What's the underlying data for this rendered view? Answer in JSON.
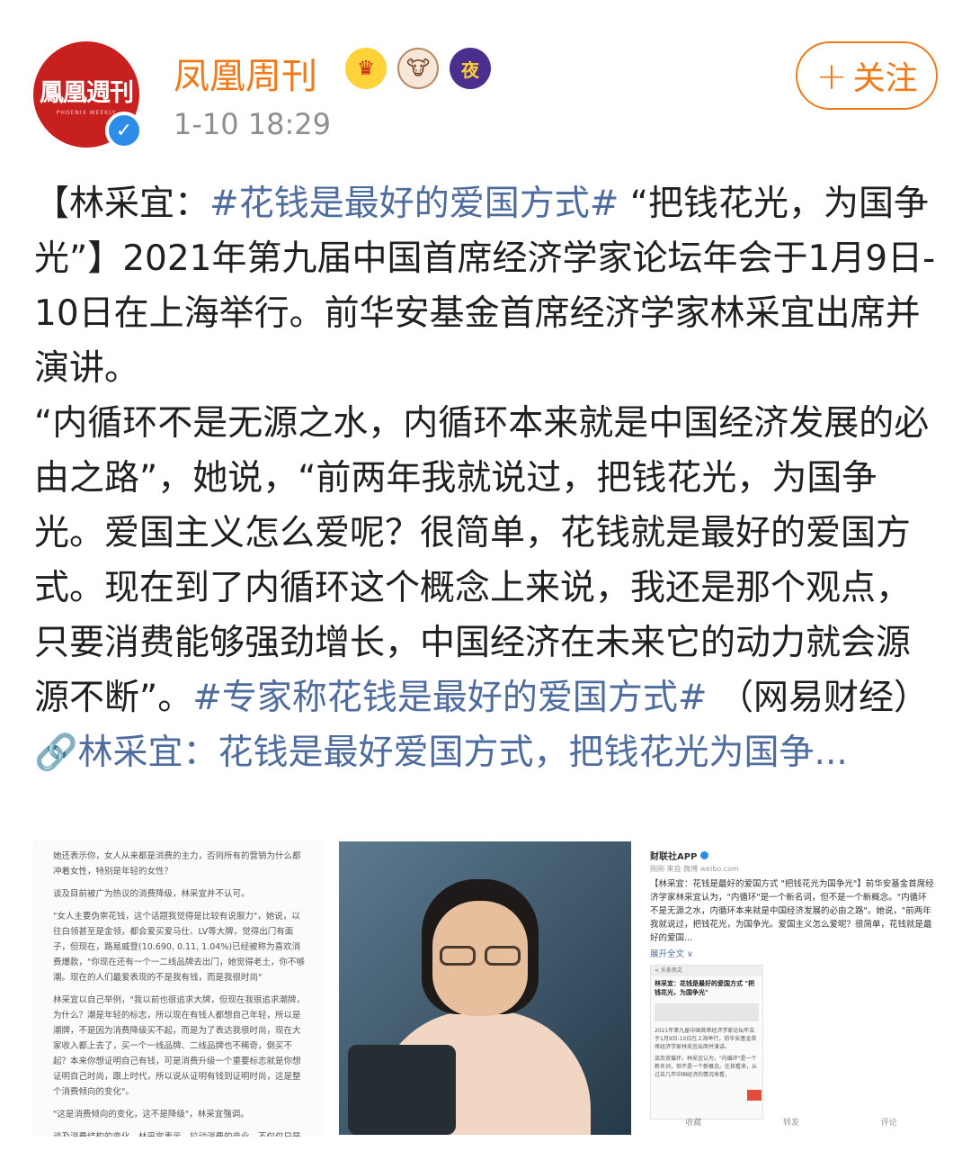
{
  "account": {
    "name": "凤凰周刊",
    "avatar_text": "鳳凰週刊",
    "avatar_subtext": "PHOENIX WEEKLY",
    "timestamp": "1-10 18:29",
    "verified_mark": "✓",
    "badges": [
      {
        "name": "crown-badge",
        "glyph": "♛"
      },
      {
        "name": "cow-badge",
        "glyph": "🐮"
      },
      {
        "name": "night-badge",
        "glyph": "夜"
      }
    ]
  },
  "follow_button": {
    "plus": "+",
    "label": "关注"
  },
  "post": {
    "segments": [
      {
        "text": "【林采宜：",
        "topic": false
      },
      {
        "text": "#花钱是最好的爱国方式#",
        "topic": true
      },
      {
        "text": " “把钱花光，为国争光”】2021年第九届中国首席经济学家论坛年会于1月9日-10日在上海举行。前华安基金首席经济学家林采宜出席并演讲。",
        "topic": false
      },
      {
        "text": "“内循环不是无源之水，内循环本来就是中国经济发展的必由之路”，她说，“前两年我就说过，把钱花光，为国争光。爱国主义怎么爱呢？很简单，花钱就是最好的爱国方式。现在到了内循环这个概念上来说，我还是那个观点，只要消费能够强劲增长，中国经济在未来它的动力就会源源不断”。",
        "topic": false
      },
      {
        "text": "#专家称花钱是最好的爱国方式#",
        "topic": true
      },
      {
        "text": " （网易财经）",
        "topic": false
      },
      {
        "text": "🔗林采宜：花钱是最好爱国方式，把钱花光为国争...",
        "topic": true
      }
    ]
  },
  "images": {
    "article_paragraphs": [
      "她还表示你，女人从来都是消费的主力，否则所有的营销为什么都冲着女性，特别是年轻的女性？",
      "谈及目前被广为热议的消费降级，林采宜并不认可。",
      "\"女人主要伪崇花钱，这个话题我觉得是比较有说服力\"，她说，以往白领甚至是金领，都会爱买爱马仕、LV等大牌，觉得出门有面子，但现在，路易威登(10.690, 0.11, 1.04%)已经被称为喜欢消费爆款，\"你现在还有一个一二线品牌去出门，她觉得老土，你不够潮。现在的人们最爱表现的不是我有钱，而是我很时尚\"",
      "林采宜以自己举例，\"我以前也很追求大牌，但现在我很追求潮牌，为什么？潮是年轻的标志，所以现在有钱人都想自己年轻，所以是潮牌，不是因为消费降级买不起，而是为了表达我很时尚，现在大家收入都上去了，买一个一线品牌、二线品牌也不稀奇，倒买不起？本来你想证明自己有钱，可是消费升级一个重要标志就是你想证明自己时尚，跟上时代，所以说从证明有钱到证明时尚，这是整个消费倾向的变化\"。",
      "\"这是消费倾向的变化，这不是降级\"，林采宜强调。",
      "谈及消费结构的变化，林采宜表示，拉动消费的产业，不仅仅只是吃"
    ],
    "screenshot": {
      "header": "财联社APP",
      "meta": "刚刚 来自 微博 weibo.com",
      "text": "【林采宜：花钱是最好的爱国方式 \"把钱花光为国争光\"】前华安基金首席经济学家林采宜认为，\"内循环\"是一个新名词，但不是一个新概念。\"内循环不是无源之水，内循环本来就是中国经济发展的必由之路\"。她说，\"前两年我就说过，把钱花光，为国争光。爱国主义怎么爱呢？很简单，花钱就是最好的爱国...",
      "more": "展开全文 ∨",
      "card_bar": "< 头条热文",
      "card_title": "林采宜：花钱是最好的爱国方式 \"把钱花光，为国争光\"",
      "card_lines": [
        "2021年第九届中国首席经济学家论坛年会于1月9日-10日在上海举行，前华安基金首席经济学家林采宜出席并演讲。",
        "谈及双循环，林采宜认为，\"内循环\"是一个新名词，但不是一个新概念。在其看来，从过去几年中国经济的情况来看，"
      ],
      "actions": [
        "收藏",
        "转发",
        "评论"
      ]
    }
  }
}
